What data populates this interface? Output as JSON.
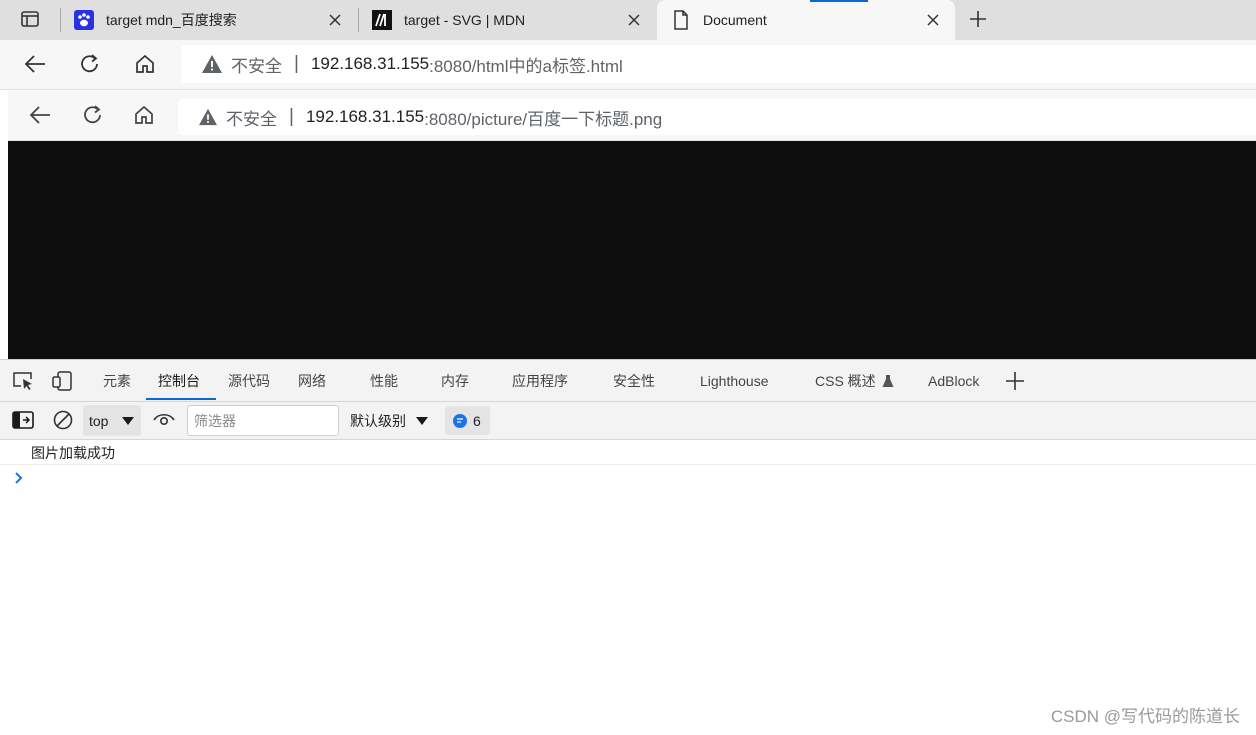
{
  "browser": {
    "tabs": [
      {
        "title": "target mdn_百度搜索",
        "favicon": "baidu-paw-icon",
        "active": false
      },
      {
        "title": "target - SVG | MDN",
        "favicon": "mdn-logo-icon",
        "active": false
      },
      {
        "title": "Document",
        "favicon": "document-icon",
        "active": true
      }
    ],
    "address": {
      "security_label": "不安全",
      "separator": "|",
      "host": "192.168.31.155",
      "rest": ":8080/html中的a标签.html"
    }
  },
  "page": {
    "address": {
      "security_label": "不安全",
      "separator": "|",
      "host": "192.168.31.155",
      "rest": ":8080/picture/百度一下标题.png"
    },
    "image_color": "#0e0e0e"
  },
  "devtools": {
    "tabs": [
      {
        "label": "元素"
      },
      {
        "label": "控制台",
        "active": true
      },
      {
        "label": "源代码"
      },
      {
        "label": "网络"
      },
      {
        "label": "性能"
      },
      {
        "label": "内存"
      },
      {
        "label": "应用程序"
      },
      {
        "label": "安全性"
      },
      {
        "label": "Lighthouse"
      },
      {
        "label": "CSS 概述"
      },
      {
        "label": "AdBlock"
      }
    ],
    "console": {
      "context": "top",
      "filter_placeholder": "筛选器",
      "level": "默认级别",
      "message_count": "6",
      "logs": [
        "图片加载成功"
      ]
    },
    "accent_color": "#0b66d6"
  },
  "watermark": "CSDN @写代码的陈道长"
}
